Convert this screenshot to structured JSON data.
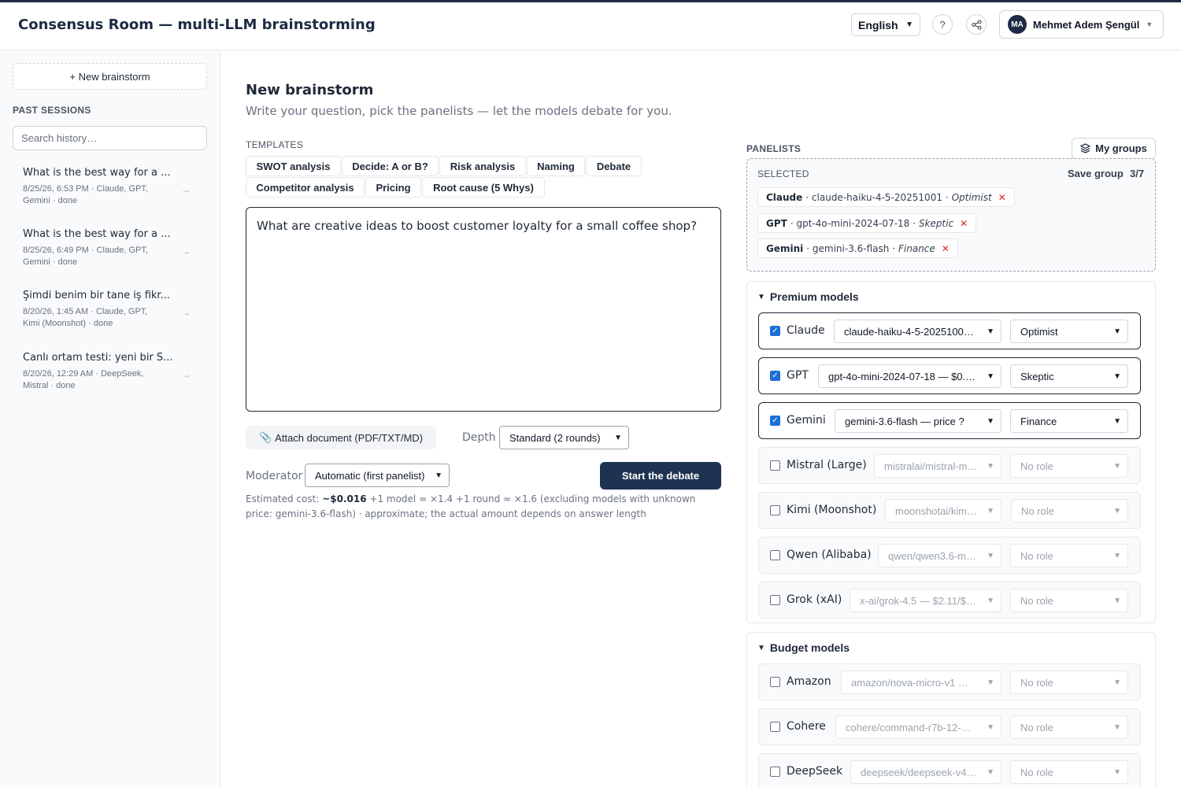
{
  "header": {
    "title": "Consensus Room — multi-LLM brainstorming",
    "language": "English",
    "help_label": "?",
    "share_icon": "share-icon",
    "user_initials": "MA",
    "user_name": "Mehmet Adem Şengül"
  },
  "sidebar": {
    "new_label": "+ New brainstorm",
    "past_label": "PAST SESSIONS",
    "search_placeholder": "Search history…",
    "sessions": [
      {
        "title": "What is the best way for a ...",
        "meta": "8/25/26, 6:53 PM · Claude, GPT, Gemini · done"
      },
      {
        "title": "What is the best way for a ...",
        "meta": "8/25/26, 6:49 PM · Claude, GPT, Gemini · done"
      },
      {
        "title": "Şimdi benim bir tane iş fikr...",
        "meta": "8/20/26, 1:45 AM · Claude, GPT, Kimi (Moonshot) · done"
      },
      {
        "title": "Canlı ortam testi: yeni bir S...",
        "meta": "8/20/26, 12:29 AM · DeepSeek, Mistral · done"
      }
    ]
  },
  "main": {
    "title": "New brainstorm",
    "subtitle": "Write your question, pick the panelists — let the models debate for you.",
    "templates_label": "TEMPLATES",
    "templates": [
      "SWOT analysis",
      "Decide: A or B?",
      "Risk analysis",
      "Naming",
      "Debate",
      "Competitor analysis",
      "Pricing",
      "Root cause (5 Whys)"
    ],
    "question": "What are creative ideas to boost customer loyalty for a small coffee shop?",
    "attach_label": "Attach document (PDF/TXT/MD)",
    "depth_label": "Depth",
    "depth_value": "Standard (2 rounds)",
    "moderator_label": "Moderator",
    "moderator_value": "Automatic (first panelist)",
    "start_label": "Start the debate",
    "cost_prefix": "Estimated cost: ",
    "cost_value": "~$0.016",
    "cost_rest": "  +1 model ≈ ×1.4   +1 round ≈ ×1.6 (excluding models with unknown price: gemini-3.6-flash) · approximate; the actual amount depends on answer length"
  },
  "panel": {
    "label": "PANELISTS",
    "my_groups": "My groups",
    "selected_label": "SELECTED",
    "save_group": "Save group",
    "count": "3/7",
    "chips": [
      {
        "provider": "Claude",
        "model": "· claude-haiku-4-5-20251001 ·",
        "role": "Optimist"
      },
      {
        "provider": "GPT",
        "model": "· gpt-4o-mini-2024-07-18 ·",
        "role": "Skeptic"
      },
      {
        "provider": "Gemini",
        "model": "· gemini-3.6-flash ·",
        "role": "Finance"
      }
    ],
    "premium_title": "Premium models",
    "premium": [
      {
        "name": "Claude",
        "model": "claude-haiku-4-5-2025100…",
        "role": "Optimist"
      },
      {
        "name": "GPT",
        "model": "gpt-4o-mini-2024-07-18 — $0.…",
        "role": "Skeptic"
      },
      {
        "name": "Gemini",
        "model": "gemini-3.6-flash — price ?",
        "role": "Finance"
      },
      {
        "name": "Mistral (Large)",
        "model": "mistralai/mistral-m…",
        "role": "No role"
      },
      {
        "name": "Kimi (Moonshot)",
        "model": "moonshotai/kim…",
        "role": "No role"
      },
      {
        "name": "Qwen (Alibaba)",
        "model": "qwen/qwen3.6-m…",
        "role": "No role"
      },
      {
        "name": "Grok (xAI)",
        "model": "x-ai/grok-4.5 — $2.11/$…",
        "role": "No role"
      }
    ],
    "budget_title": "Budget models",
    "budget": [
      {
        "name": "Amazon",
        "model": "amazon/nova-micro-v1 …",
        "role": "No role"
      },
      {
        "name": "Cohere",
        "model": "cohere/command-r7b-12-…",
        "role": "No role"
      },
      {
        "name": "DeepSeek",
        "model": "deepseek/deepseek-v4…",
        "role": "No role"
      }
    ]
  }
}
